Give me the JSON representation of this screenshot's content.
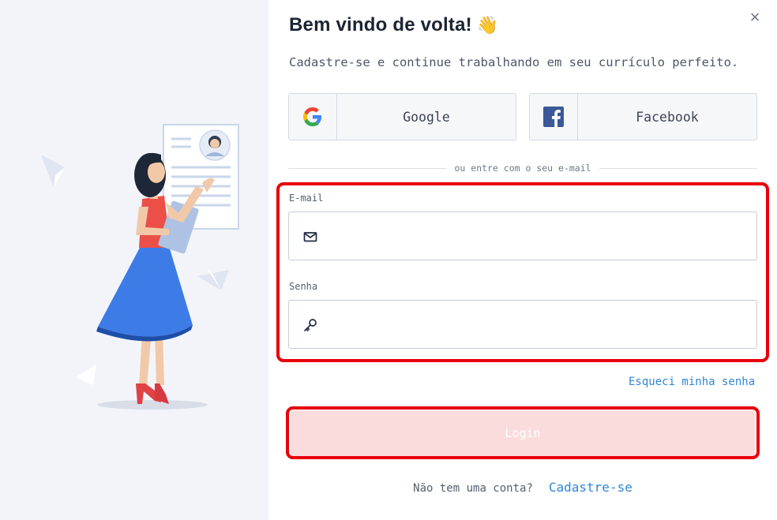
{
  "left_panel": {
    "background": "#f3f4f9",
    "illustration": "woman-holding-resume-illustration"
  },
  "modal": {
    "close_icon": "×",
    "title": "Bem vindo de volta!",
    "title_emoji": "👋",
    "subtitle": "Cadastre-se e continue trabalhando em seu currículo perfeito.",
    "social": {
      "google": {
        "label": "Google",
        "icon": "google-g-icon"
      },
      "facebook": {
        "label": "Facebook",
        "icon": "facebook-f-icon"
      }
    },
    "divider_text": "ou entre com o seu e-mail",
    "email": {
      "label": "E-mail",
      "value": "",
      "placeholder": "",
      "icon": "envelope-icon"
    },
    "password": {
      "label": "Senha",
      "value": "",
      "placeholder": "",
      "icon": "key-icon"
    },
    "forgot_link": "Esqueci minha senha",
    "login_button": "Login",
    "signup_question": "Não tem uma conta?",
    "signup_link": "Cadastre-se"
  },
  "colors": {
    "accent_link": "#2f86d6",
    "login_button_bg": "#fadcdd",
    "highlight_red": "#e8000b",
    "facebook_blue": "#3b5998"
  }
}
